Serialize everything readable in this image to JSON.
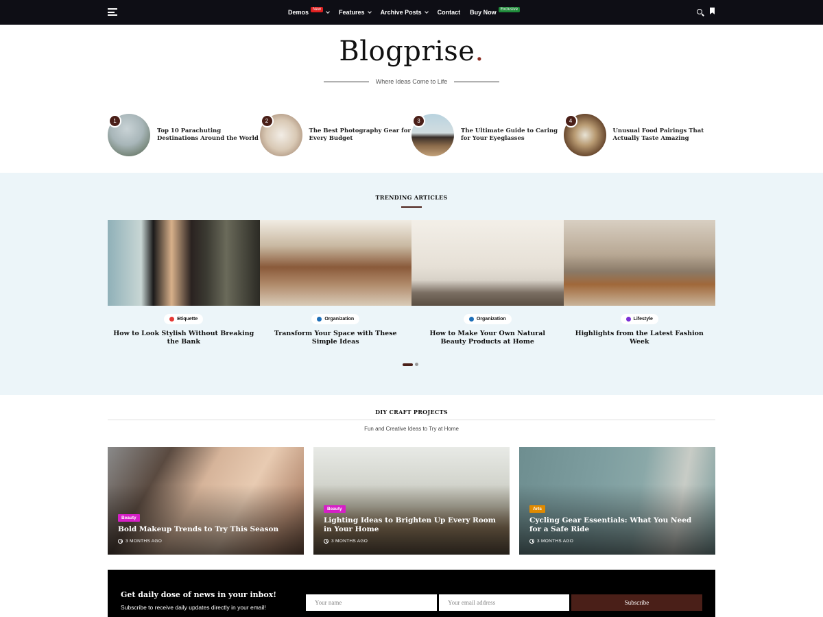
{
  "nav": {
    "items": [
      {
        "label": "Demos",
        "badge": "New",
        "has_dropdown": true
      },
      {
        "label": "Features",
        "has_dropdown": true
      },
      {
        "label": "Archive Posts",
        "has_dropdown": true
      },
      {
        "label": "Contact"
      },
      {
        "label": "Buy Now",
        "badge": "Exclusive"
      }
    ],
    "icons": [
      "menu-icon",
      "search-icon",
      "bookmark-icon"
    ]
  },
  "brand": {
    "name": "Blogprise",
    "dot": ".",
    "tagline": "Where Ideas Come to Life",
    "accent": "#8a2a1f"
  },
  "featured": [
    {
      "num": "1",
      "title": "Top 10 Parachuting Destinations Around the World"
    },
    {
      "num": "2",
      "title": "The Best Photography Gear for Every Budget"
    },
    {
      "num": "3",
      "title": "The Ultimate Guide to Caring for Your Eyeglasses"
    },
    {
      "num": "4",
      "title": "Unusual Food Pairings That Actually Taste Amazing"
    }
  ],
  "trending": {
    "heading": "TRENDING ARTICLES",
    "cards": [
      {
        "category": "Etiquette",
        "category_color": "#e53935",
        "title": "How to Look Stylish Without Breaking the Bank"
      },
      {
        "category": "Organization",
        "category_color": "#1e6fb8",
        "title": "Transform Your Space with These Simple Ideas"
      },
      {
        "category": "Organization",
        "category_color": "#1e6fb8",
        "title": "How to Make Your Own Natural Beauty Products at Home"
      },
      {
        "category": "Lifestyle",
        "category_color": "#7b2fd6",
        "title": "Highlights from the Latest Fashion Week"
      }
    ]
  },
  "diy": {
    "heading": "DIY CRAFT PROJECTS",
    "subheading": "Fun and Creative Ideas to Try at Home",
    "cards": [
      {
        "tag": "Beauty",
        "tag_color": "#d61fc7",
        "title": "Bold Makeup Trends to Try This Season",
        "meta": "3 MONTHS AGO"
      },
      {
        "tag": "Beauty",
        "tag_color": "#d61fc7",
        "title": "Lighting Ideas to Brighten Up Every Room in Your Home",
        "meta": "3 MONTHS AGO"
      },
      {
        "tag": "Arts",
        "tag_color": "#e08a00",
        "title": "Cycling Gear Essentials: What You Need for a Safe Ride",
        "meta": "3 MONTHS AGO"
      }
    ]
  },
  "newsletter": {
    "title": "Get daily dose of news in your inbox!",
    "subtitle": "Subscribe to receive daily updates directly in your email!",
    "name_placeholder": "Your name",
    "email_placeholder": "Your email address",
    "button": "Subscribe"
  }
}
